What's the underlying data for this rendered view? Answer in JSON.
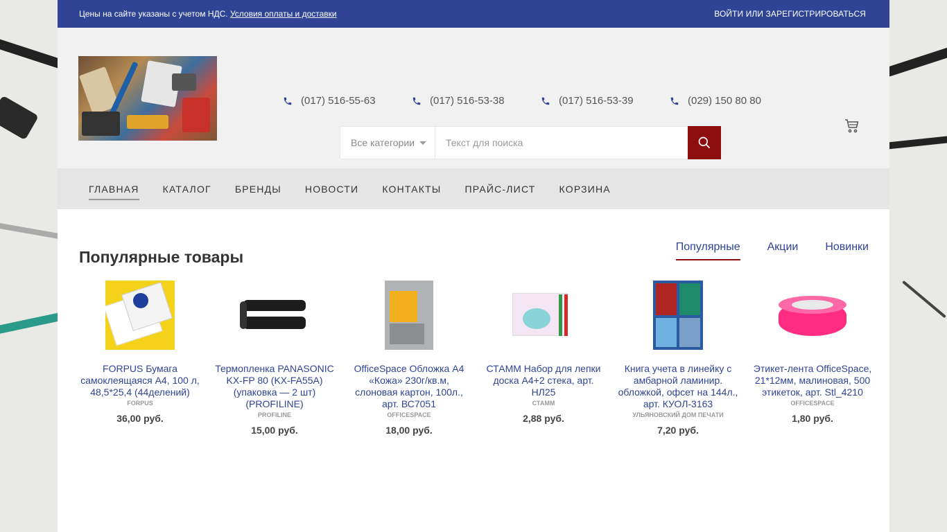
{
  "topbar": {
    "notice": "Цены на сайте указаны с учетом НДС.",
    "notice_link": "Условия оплаты и доставки",
    "login": "ВОЙТИ ИЛИ ЗАРЕГИСТРИРОВАТЬСЯ"
  },
  "header": {
    "phones": [
      "(017) 516-55-63",
      "(017) 516-53-38",
      "(017) 516-53-39",
      "(029) 150 80 80"
    ],
    "search": {
      "category": "Все категории",
      "placeholder": "Текст для поиска"
    }
  },
  "nav": {
    "items": [
      "ГЛАВНАЯ",
      "КАТАЛОГ",
      "БРЕНДЫ",
      "НОВОСТИ",
      "КОНТАКТЫ",
      "ПРАЙС-ЛИСТ",
      "КОРЗИНА"
    ]
  },
  "main": {
    "title": "Популярные товары",
    "tabs": [
      "Популярные",
      "Акции",
      "Новинки"
    ],
    "products": [
      {
        "name": "FORPUS Бумага самоклеящаяся А4, 100 л, 48,5*25,4 (44делений)",
        "brand": "FORPUS",
        "price": "36,00 руб."
      },
      {
        "name": "Термопленка PANASONIC KX-FP 80 (KX-FA55A) (упаковка — 2 шт) (PROFILINE)",
        "brand": "PROFILINE",
        "price": "15,00 руб."
      },
      {
        "name": "OfficeSpace Обложка А4 «Кожа» 230г/кв.м, слоновая картон, 100л., арт. ВС7051",
        "brand": "OFFICESPACE",
        "price": "18,00 руб."
      },
      {
        "name": "СТАММ Набор для лепки доска А4+2 стека, арт. НЛ25",
        "brand": "СТАММ",
        "price": "2,88 руб."
      },
      {
        "name": "Книга учета в линейку с амбарной ламинир. обложкой, офсет на 144л., арт. КУОЛ-3163",
        "brand": "УЛЬЯНОВСКИЙ ДОМ ПЕЧАТИ",
        "price": "7,20 руб."
      },
      {
        "name": "Этикет-лента OfficeSpace, 21*12мм, малиновая, 500 этикеток, арт. Stl_4210",
        "brand": "OFFICESPACE",
        "price": "1,80 руб."
      }
    ]
  },
  "colors": {
    "brand_blue": "#2f4494",
    "accent_red": "#8c0e0e"
  }
}
